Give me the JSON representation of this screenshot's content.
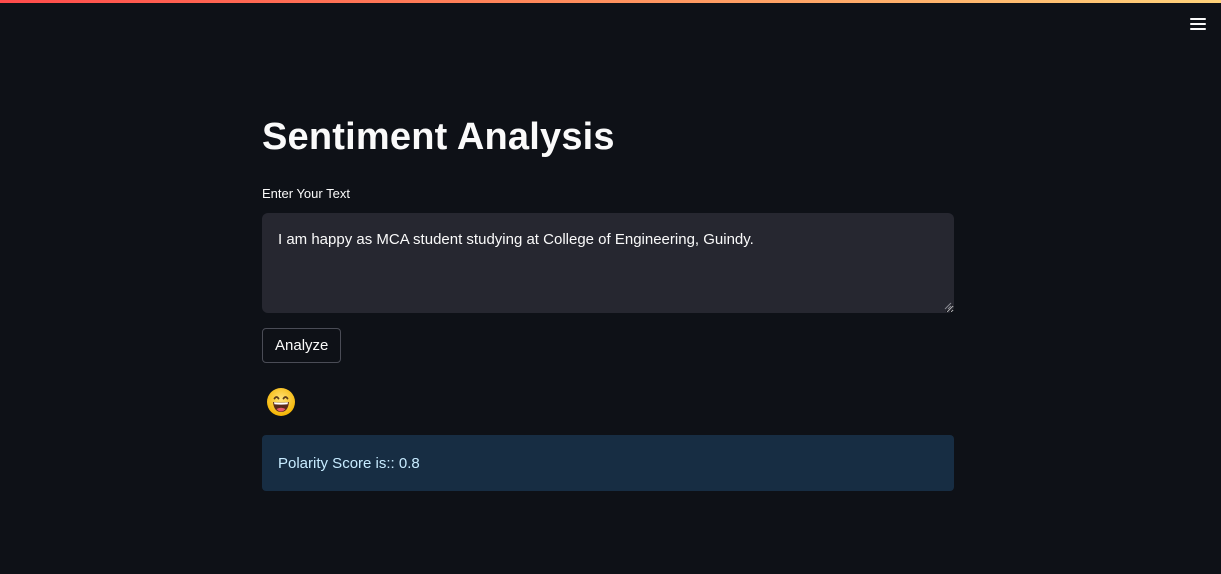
{
  "app": {
    "title": "Sentiment Analysis",
    "accent_gradient": [
      "#ff4b4b",
      "#ffd27a"
    ],
    "background": "#0e1117"
  },
  "menu": {
    "icon": "hamburger-menu-icon"
  },
  "form": {
    "input_label": "Enter Your Text",
    "input_value": "I am happy as MCA student studying at College of Engineering, Guindy.",
    "button_label": "Analyze"
  },
  "result": {
    "emoji": "grinning-face-icon",
    "polarity_text": "Polarity Score is:: 0.8",
    "polarity_score": 0.8,
    "info_color": "#172d43"
  }
}
